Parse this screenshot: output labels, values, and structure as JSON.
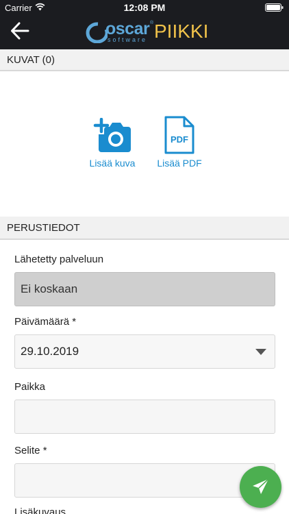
{
  "status_bar": {
    "carrier": "Carrier",
    "time": "12:08 PM"
  },
  "header": {
    "logo": {
      "oscar": "oscar",
      "reg": "®",
      "software": "software",
      "piikki": "PIIKKI"
    }
  },
  "kuvat_section": {
    "title": "KUVAT (0)",
    "add_image_label": "Lisää kuva",
    "add_pdf_label": "Lisää PDF",
    "pdf_icon_text": "PDF"
  },
  "perustiedot_section": {
    "title": "PERUSTIEDOT"
  },
  "fields": {
    "sent": {
      "label": "Lähetetty palveluun",
      "value": "Ei koskaan"
    },
    "date": {
      "label": "Päivämäärä *",
      "value": "29.10.2019"
    },
    "place": {
      "label": "Paikka",
      "value": ""
    },
    "explanation": {
      "label": "Selite *",
      "value": ""
    },
    "extra": {
      "label": "Lisäkuvaus"
    }
  },
  "colors": {
    "accent": "#1a8ccf",
    "fab": "#4caf50",
    "header": "#1b1c20",
    "logo_blue": "#5da7d8",
    "logo_yellow": "#f0c24a"
  }
}
